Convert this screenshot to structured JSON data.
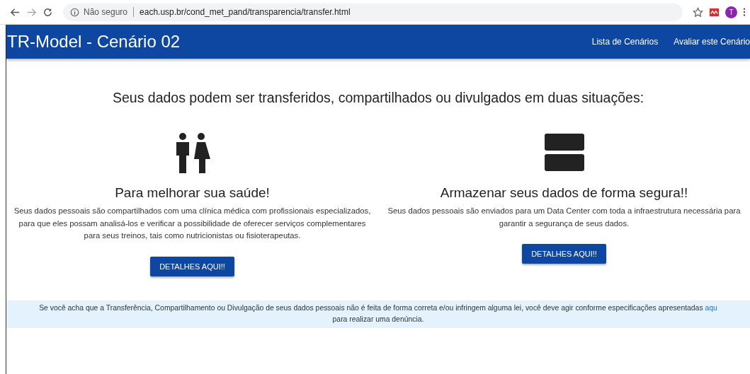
{
  "browser": {
    "security": "Não seguro",
    "url": "each.usp.br/cond_met_pand/transparencia/transfer.html",
    "avatar": "T"
  },
  "navbar": {
    "title": "TR-Model - Cenário 02",
    "links": [
      "Lista de Cenários",
      "Avaliar este Cenário"
    ]
  },
  "heading": "Seus dados podem ser transferidos, compartilhados ou divulgados em duas situações:",
  "cards": [
    {
      "kind": "people",
      "title": "Para melhorar sua saúde!",
      "text": "Seus dados pessoais são compartilhados com uma clínica médica com profissionais especializados, para que eles possam analisá-los e verificar a possibilidade de oferecer serviços complementares para seus treinos, tais como nutricionistas ou fisioterapeutas.",
      "button": "DETALHES AQUI!!"
    },
    {
      "kind": "storage",
      "title": "Armazenar seus dados de forma segura!!",
      "text": "Seus dados pessoais são enviados para um Data Center com toda a infraestrutura necessária para garantir a segurança de seus dados.",
      "button": "DETALHES AQUI!!"
    }
  ],
  "notice": {
    "text": "Se você acha que a Transferência, Compartilhamento ou Divulgação de seus dados pessoais não é feita de forma correta e/ou infringem alguma lei, você deve agir conforme especificações apresentadas",
    "link": "aqu",
    "text_after": "para realizar uma denúncia."
  }
}
